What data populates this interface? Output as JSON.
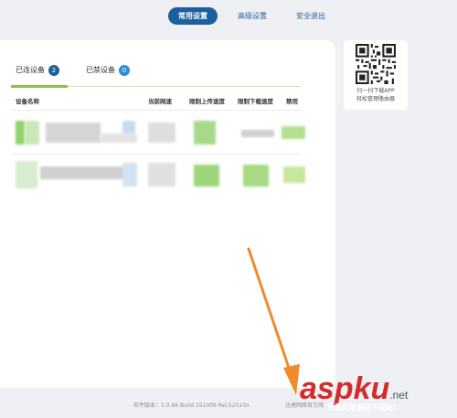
{
  "nav": {
    "items": [
      {
        "label": "常用设置",
        "active": true
      },
      {
        "label": "高级设置",
        "active": false
      },
      {
        "label": "安全退出",
        "active": false
      }
    ]
  },
  "tabs": [
    {
      "label": "已连设备",
      "count": "2",
      "active": true,
      "badge_color": "#1d5e9c"
    },
    {
      "label": "已禁设备",
      "count": "0",
      "active": false,
      "badge_color": "#2b8fd6"
    }
  ],
  "table": {
    "headers": [
      "设备名称",
      "当前网速",
      "限制上传速度",
      "限制下载速度",
      "禁用"
    ]
  },
  "qr": {
    "caption_line1": "扫一扫下载APP",
    "caption_line2": "轻松管理路由器"
  },
  "footer": {
    "version": "软件版本：1.0.66 Build 151009 Rel.52510n",
    "link": "迅捷网络官方网"
  },
  "watermark": {
    "text": "aspku",
    "suffix": ".net",
    "sub": "免费网站源码下载站!"
  },
  "colors": {
    "accent": "#1d5e9c",
    "tab_underline": "#8bc34a",
    "arrow": "#f08a2c",
    "watermark": "#d52b2b"
  }
}
